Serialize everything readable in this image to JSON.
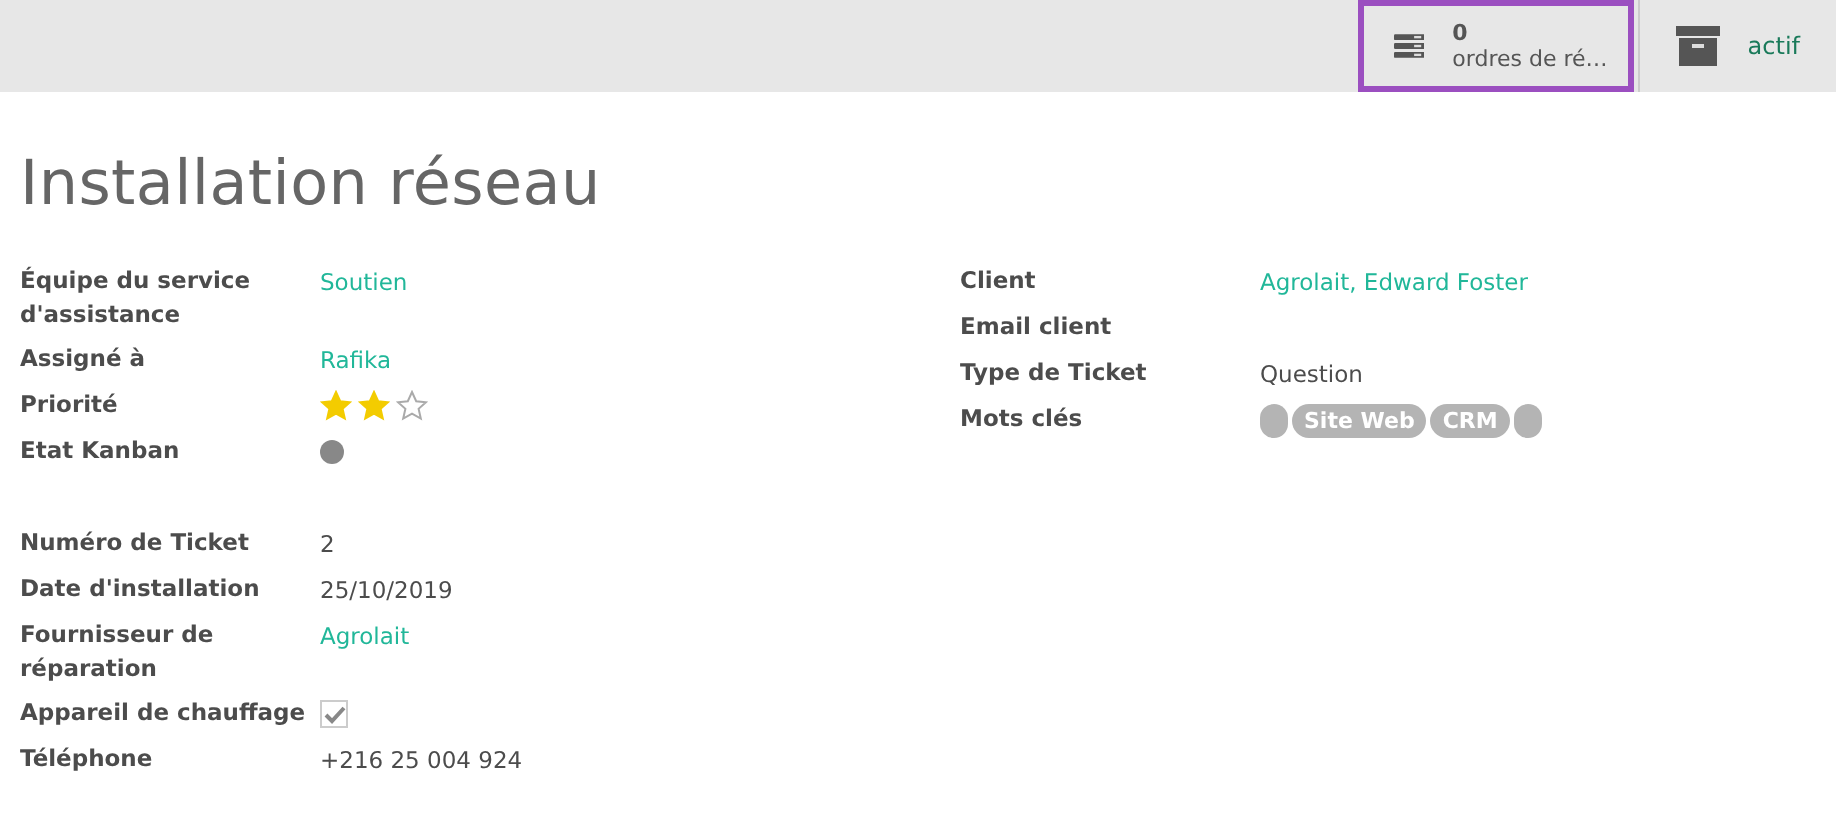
{
  "smart_buttons": [
    {
      "kind": "count",
      "value": "0",
      "label": "ordres de ré…",
      "selected": true
    },
    {
      "kind": "toggle",
      "label": "actif",
      "selected": false
    }
  ],
  "title": "Installation réseau",
  "left_group": [
    {
      "label": "Équipe du service d'assistance",
      "kind": "link",
      "value": "Soutien"
    },
    {
      "label": "Assigné à",
      "kind": "link",
      "value": "Rafika"
    },
    {
      "label": "Priorité",
      "kind": "stars",
      "stars": 2
    },
    {
      "label": "Etat Kanban",
      "kind": "dot",
      "color": "#888888"
    }
  ],
  "right_group": [
    {
      "label": "Client",
      "kind": "link",
      "value": "Agrolait, Edward Foster"
    },
    {
      "label": "Email client",
      "kind": "empty"
    },
    {
      "label": "Type de Ticket",
      "kind": "text",
      "value": "Question"
    },
    {
      "label": "Mots clés",
      "kind": "tags",
      "tags": [
        {
          "kind": "blank"
        },
        {
          "kind": "label",
          "label": "Site Web"
        },
        {
          "kind": "label",
          "label": "CRM"
        },
        {
          "kind": "blank"
        }
      ]
    }
  ],
  "lower_group": [
    {
      "label": "Numéro de Ticket",
      "kind": "text",
      "value": "2"
    },
    {
      "label": "Date d'installation",
      "kind": "text",
      "value": "25/10/2019"
    },
    {
      "label": "Fournisseur de réparation",
      "kind": "link",
      "value": "Agrolait"
    },
    {
      "label": "Appareil de chauffage",
      "kind": "checkbox",
      "checked": true
    },
    {
      "label": "Téléphone",
      "kind": "text",
      "value": "+216 25 004 924"
    }
  ]
}
